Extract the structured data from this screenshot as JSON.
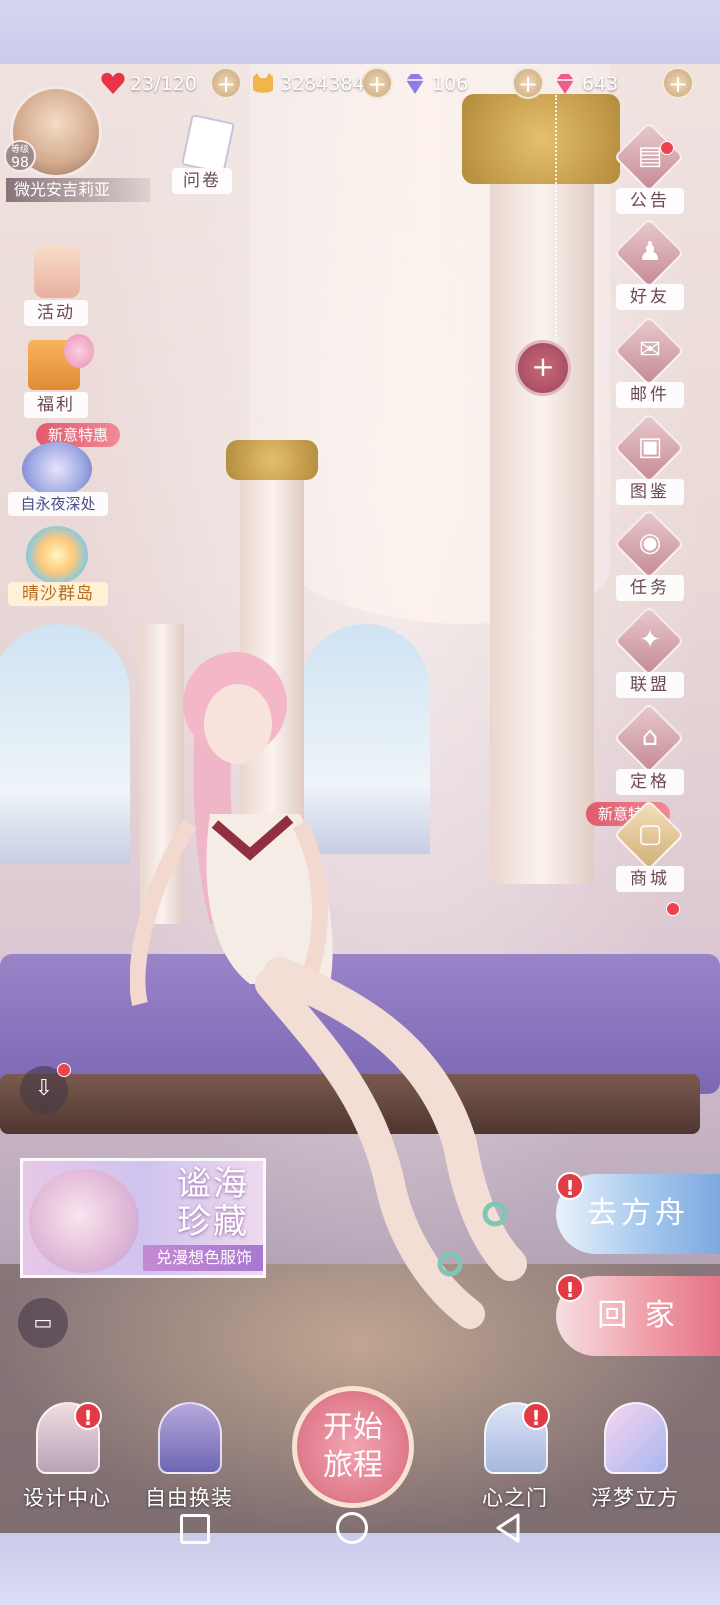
{
  "resources": {
    "stamina": "23/120",
    "gold": "3284384",
    "diamond": "106",
    "gem": "643"
  },
  "player": {
    "level_label": "等级",
    "level": "98",
    "name": "微光安吉莉亚"
  },
  "left_menu": {
    "survey": "问卷",
    "activity": "活动",
    "welfare": "福利",
    "promo_tag": "新意特惠",
    "event1": "自永夜深处",
    "event2": "晴沙群岛"
  },
  "right_menu": [
    {
      "label": "公告",
      "glyph": "▤"
    },
    {
      "label": "好友",
      "glyph": "♟"
    },
    {
      "label": "邮件",
      "glyph": "✉"
    },
    {
      "label": "图鉴",
      "glyph": "▣"
    },
    {
      "label": "任务",
      "glyph": "◉"
    },
    {
      "label": "联盟",
      "glyph": "✦"
    },
    {
      "label": "定格",
      "glyph": "⌂"
    },
    {
      "label": "商城",
      "glyph": "▢"
    }
  ],
  "shop_promo_tag": "新意特惠",
  "banner": {
    "title_line1": "谧海",
    "title_line2": "珍藏",
    "subtitle": "兑漫想色服饰"
  },
  "side_buttons": {
    "ark": "去方舟",
    "home": "回 家"
  },
  "bottom_nav": {
    "design_center": "设计中心",
    "free_outfit": "自由换装",
    "start_line1": "开始",
    "start_line2": "旅程",
    "heart_gate": "心之门",
    "dream_cube": "浮梦立方"
  },
  "colors": {
    "accent_pink": "#e07d8f",
    "red_dot": "#f0424e",
    "label_text": "#6b4b4f"
  }
}
